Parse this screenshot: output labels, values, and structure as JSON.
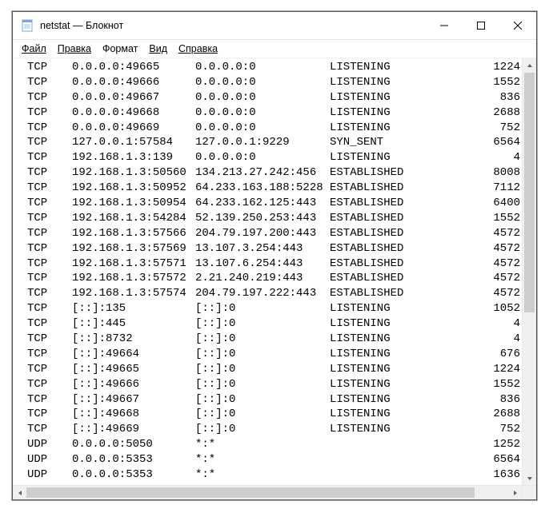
{
  "window": {
    "title": "netstat — Блокнот"
  },
  "menu": {
    "file": "Файл",
    "edit": "Правка",
    "format": "Формат",
    "view": "Вид",
    "help": "Справка"
  },
  "rows": [
    {
      "proto": "TCP",
      "local": "0.0.0.0:49665",
      "remote": "0.0.0.0:0",
      "state": "LISTENING",
      "pid": "1224"
    },
    {
      "proto": "TCP",
      "local": "0.0.0.0:49666",
      "remote": "0.0.0.0:0",
      "state": "LISTENING",
      "pid": "1552"
    },
    {
      "proto": "TCP",
      "local": "0.0.0.0:49667",
      "remote": "0.0.0.0:0",
      "state": "LISTENING",
      "pid": "836"
    },
    {
      "proto": "TCP",
      "local": "0.0.0.0:49668",
      "remote": "0.0.0.0:0",
      "state": "LISTENING",
      "pid": "2688"
    },
    {
      "proto": "TCP",
      "local": "0.0.0.0:49669",
      "remote": "0.0.0.0:0",
      "state": "LISTENING",
      "pid": "752"
    },
    {
      "proto": "TCP",
      "local": "127.0.0.1:57584",
      "remote": "127.0.0.1:9229",
      "state": "SYN_SENT",
      "pid": "6564"
    },
    {
      "proto": "TCP",
      "local": "192.168.1.3:139",
      "remote": "0.0.0.0:0",
      "state": "LISTENING",
      "pid": "4"
    },
    {
      "proto": "TCP",
      "local": "192.168.1.3:50560",
      "remote": "134.213.27.242:456",
      "state": "ESTABLISHED",
      "pid": "8008"
    },
    {
      "proto": "TCP",
      "local": "192.168.1.3:50952",
      "remote": "64.233.163.188:5228",
      "state": "ESTABLISHED",
      "pid": "7112"
    },
    {
      "proto": "TCP",
      "local": "192.168.1.3:50954",
      "remote": "64.233.162.125:443",
      "state": "ESTABLISHED",
      "pid": "6400"
    },
    {
      "proto": "TCP",
      "local": "192.168.1.3:54284",
      "remote": "52.139.250.253:443",
      "state": "ESTABLISHED",
      "pid": "1552"
    },
    {
      "proto": "TCP",
      "local": "192.168.1.3:57566",
      "remote": "204.79.197.200:443",
      "state": "ESTABLISHED",
      "pid": "4572"
    },
    {
      "proto": "TCP",
      "local": "192.168.1.3:57569",
      "remote": "13.107.3.254:443",
      "state": "ESTABLISHED",
      "pid": "4572"
    },
    {
      "proto": "TCP",
      "local": "192.168.1.3:57571",
      "remote": "13.107.6.254:443",
      "state": "ESTABLISHED",
      "pid": "4572"
    },
    {
      "proto": "TCP",
      "local": "192.168.1.3:57572",
      "remote": "2.21.240.219:443",
      "state": "ESTABLISHED",
      "pid": "4572"
    },
    {
      "proto": "TCP",
      "local": "192.168.1.3:57574",
      "remote": "204.79.197.222:443",
      "state": "ESTABLISHED",
      "pid": "4572"
    },
    {
      "proto": "TCP",
      "local": "[::]:135",
      "remote": "[::]:0",
      "state": "LISTENING",
      "pid": "1052"
    },
    {
      "proto": "TCP",
      "local": "[::]:445",
      "remote": "[::]:0",
      "state": "LISTENING",
      "pid": "4"
    },
    {
      "proto": "TCP",
      "local": "[::]:8732",
      "remote": "[::]:0",
      "state": "LISTENING",
      "pid": "4"
    },
    {
      "proto": "TCP",
      "local": "[::]:49664",
      "remote": "[::]:0",
      "state": "LISTENING",
      "pid": "676"
    },
    {
      "proto": "TCP",
      "local": "[::]:49665",
      "remote": "[::]:0",
      "state": "LISTENING",
      "pid": "1224"
    },
    {
      "proto": "TCP",
      "local": "[::]:49666",
      "remote": "[::]:0",
      "state": "LISTENING",
      "pid": "1552"
    },
    {
      "proto": "TCP",
      "local": "[::]:49667",
      "remote": "[::]:0",
      "state": "LISTENING",
      "pid": "836"
    },
    {
      "proto": "TCP",
      "local": "[::]:49668",
      "remote": "[::]:0",
      "state": "LISTENING",
      "pid": "2688"
    },
    {
      "proto": "TCP",
      "local": "[::]:49669",
      "remote": "[::]:0",
      "state": "LISTENING",
      "pid": "752"
    },
    {
      "proto": "UDP",
      "local": "0.0.0.0:5050",
      "remote": "*:*",
      "state": "",
      "pid": "1252"
    },
    {
      "proto": "UDP",
      "local": "0.0.0.0:5353",
      "remote": "*:*",
      "state": "",
      "pid": "6564"
    },
    {
      "proto": "UDP",
      "local": "0.0.0.0:5353",
      "remote": "*:*",
      "state": "",
      "pid": "1636"
    }
  ]
}
